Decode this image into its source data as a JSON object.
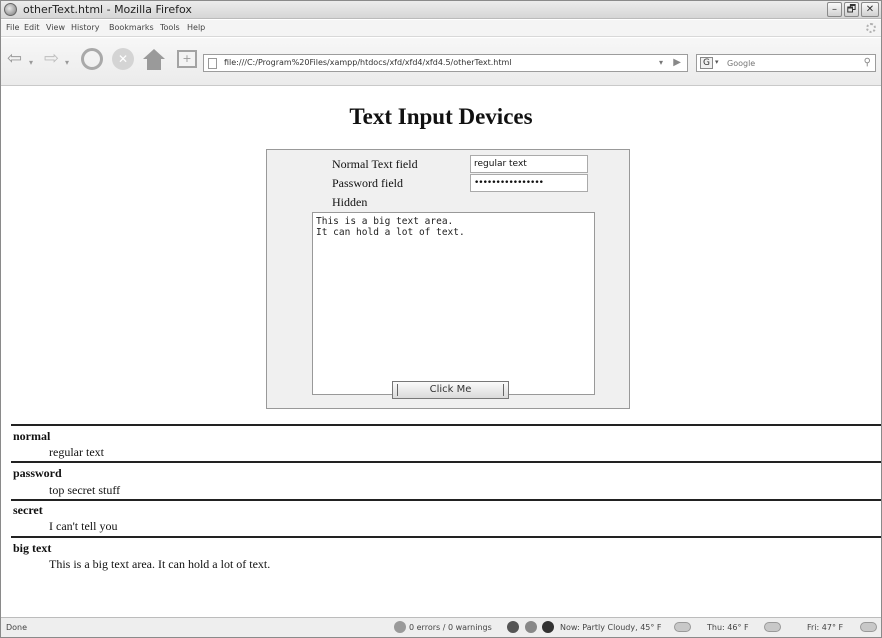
{
  "window": {
    "title": "otherText.html - Mozilla Firefox"
  },
  "window_buttons": {
    "minimize": "–",
    "maximize": "🗗",
    "close": "✕"
  },
  "menu": [
    "File",
    "Edit",
    "View",
    "History",
    "Bookmarks",
    "Tools",
    "Help"
  ],
  "navbar": {
    "url": "file:///C:/Program%20Files/xampp/htdocs/xfd/xfd4/xfd4.5/otherText.html",
    "search_placeholder": "Google",
    "search_engine_icon": "G"
  },
  "page": {
    "heading": "Text Input Devices",
    "form": {
      "normal_label": "Normal Text field",
      "normal_value": "regular text",
      "password_label": "Password field",
      "password_value": "top secret stuff",
      "hidden_label": "Hidden",
      "textarea_value": "This is a big text area.\nIt can hold a lot of text.",
      "button_label": "Click Me"
    },
    "results": [
      {
        "term": "normal",
        "value": "regular text"
      },
      {
        "term": "password",
        "value": "top secret stuff"
      },
      {
        "term": "secret",
        "value": "I can't tell you"
      },
      {
        "term": "big text",
        "value": "This is a big text area. It can hold a lot of text."
      }
    ]
  },
  "status": {
    "text": "Done",
    "errors": "0 errors / 0 warnings",
    "weather_now": "Now: Partly Cloudy, 45° F",
    "weather_thu": "Thu: 46° F",
    "weather_fri": "Fri: 47° F"
  }
}
